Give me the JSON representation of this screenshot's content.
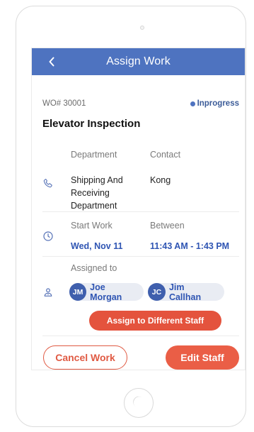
{
  "header": {
    "title": "Assign Work",
    "back_icon": "chevron-left-icon"
  },
  "work_order": {
    "number": "WO# 30001",
    "status": "Inprogress",
    "title": "Elevator Inspection"
  },
  "details": {
    "department_label": "Department",
    "department_lines": [
      "Shipping And",
      "Receiving",
      "Department"
    ],
    "contact_label": "Contact",
    "contact_value": "Kong",
    "start_label": "Start Work",
    "start_value": "Wed, Nov 11",
    "between_label": "Between",
    "between_value": "11:43 AM - 1:43 PM",
    "assigned_label": "Assigned to"
  },
  "assignees": [
    {
      "initials": "JM",
      "name": "Joe Morgan"
    },
    {
      "initials": "JC",
      "name": "Jim Callhan"
    }
  ],
  "buttons": {
    "assign_different": "Assign to Different Staff",
    "cancel": "Cancel Work",
    "edit": "Edit Staff"
  },
  "colors": {
    "header": "#4e73c0",
    "accent_orange": "#e4533d",
    "link_blue": "#2f55b3",
    "chip_bg": "#e9ecf3"
  }
}
